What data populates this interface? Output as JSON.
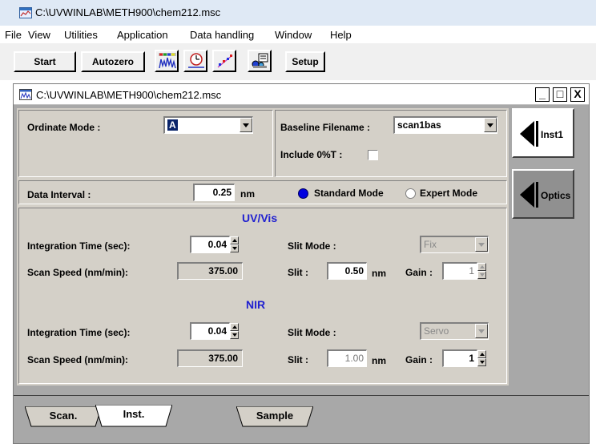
{
  "app": {
    "title": "C:\\UVWINLAB\\METH900\\chem212.msc"
  },
  "menu": [
    "File",
    "View",
    "Utilities",
    "Application",
    "Data handling",
    "Window",
    "Help"
  ],
  "toolbar": {
    "start_label": "Start",
    "autozero_label": "Autozero",
    "setup_label": "Setup",
    "icons": [
      "spectrum-icon",
      "timedrive-icon",
      "wavelength-program-icon",
      "sample-changer-icon"
    ]
  },
  "child_window": {
    "title": "C:\\UVWINLAB\\METH900\\chem212.msc",
    "minimize": "_",
    "maximize": "□",
    "close": "X"
  },
  "ordinate": {
    "label": "Ordinate Mode :",
    "value": "A"
  },
  "baseline": {
    "label": "Baseline Filename :",
    "value": "scan1bas"
  },
  "include_0t": {
    "label": "Include 0%T :",
    "checked": false
  },
  "data_interval": {
    "label": "Data Interval :",
    "value": "0.25",
    "unit": "nm"
  },
  "mode": {
    "standard_label": "Standard Mode",
    "expert_label": "Expert Mode",
    "selected": "standard"
  },
  "uvvis": {
    "heading": "UV/Vis",
    "integration_label": "Integration Time (sec):",
    "integration_value": "0.04",
    "scan_speed_label": "Scan Speed (nm/min):",
    "scan_speed_value": "375.00",
    "slit_mode_label": "Slit Mode :",
    "slit_mode_value": "Fix",
    "slit_label": "Slit :",
    "slit_value": "0.50",
    "slit_unit": "nm",
    "gain_label": "Gain :",
    "gain_value": "1"
  },
  "nir": {
    "heading": "NIR",
    "integration_label": "Integration Time (sec):",
    "integration_value": "0.04",
    "scan_speed_label": "Scan Speed (nm/min):",
    "scan_speed_value": "375.00",
    "slit_mode_label": "Slit Mode :",
    "slit_mode_value": "Servo",
    "slit_label": "Slit :",
    "slit_value": "1.00",
    "slit_unit": "nm",
    "gain_label": "Gain :",
    "gain_value": "1"
  },
  "side_buttons": {
    "inst1": "Inst1",
    "optics": "Optics"
  },
  "tabs": [
    "Scan.",
    "Inst.",
    "Sample"
  ],
  "active_tab": "Inst."
}
